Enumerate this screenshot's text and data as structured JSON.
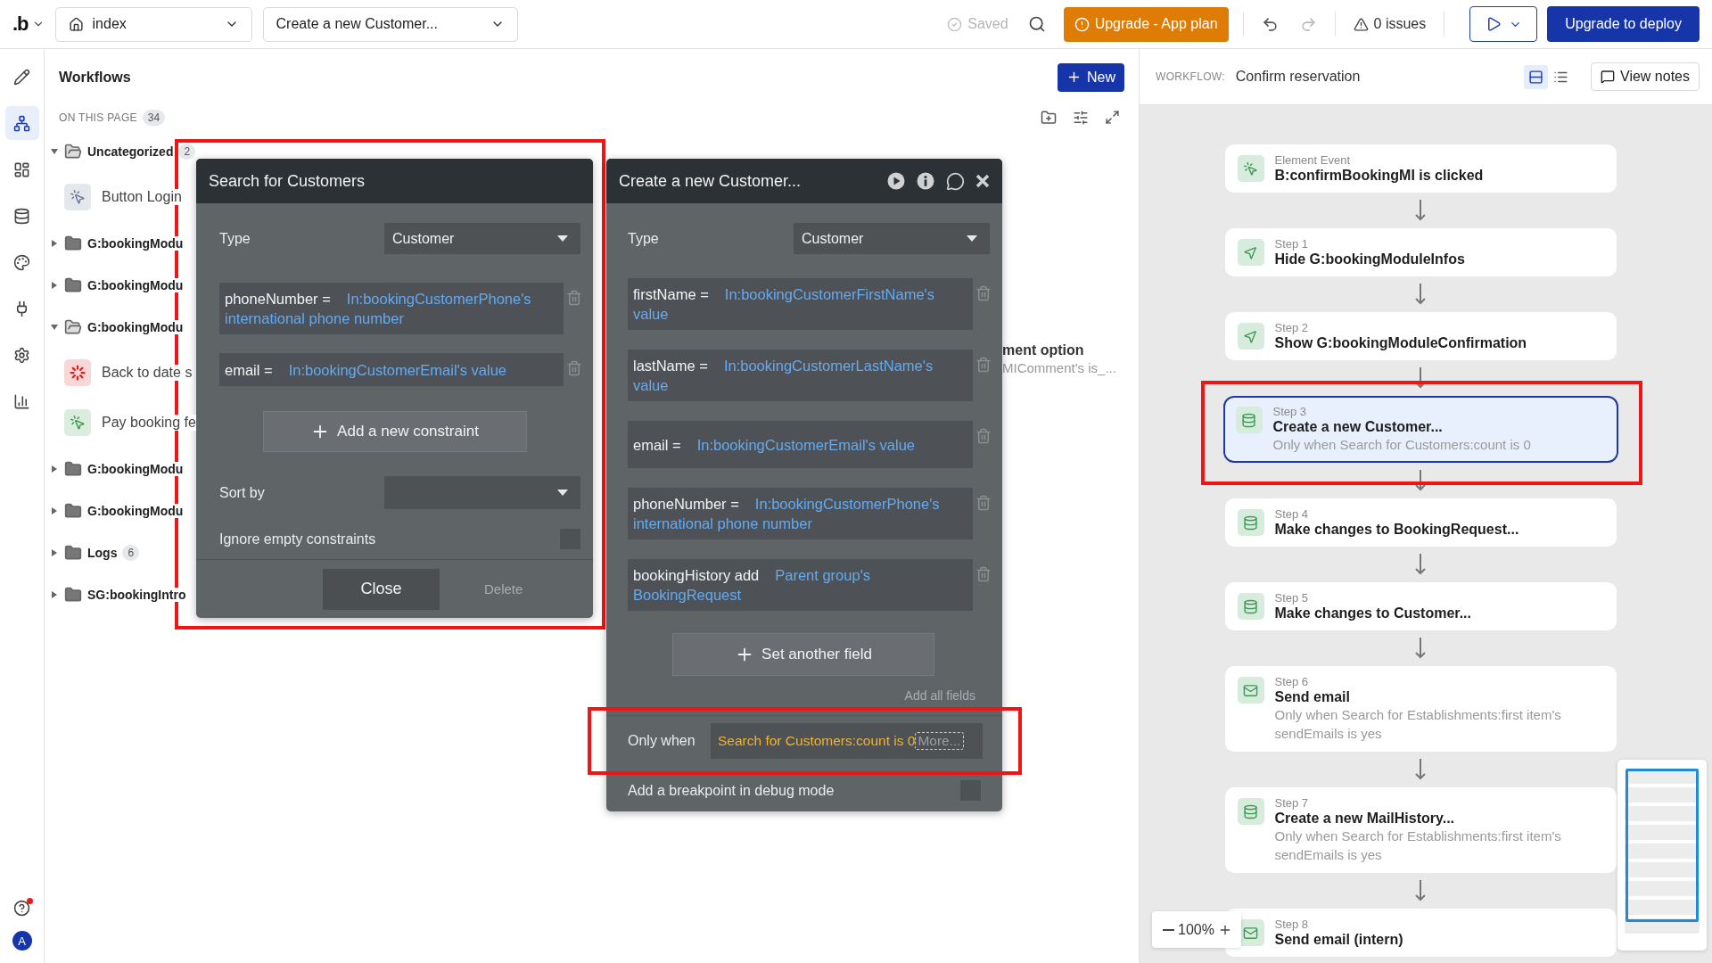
{
  "top_bar": {
    "logo": ".b",
    "page_selector": "index",
    "workflow_selector": "Create a new Customer...",
    "saved": "Saved",
    "upgrade_plan": "Upgrade - App plan",
    "issues": "0 issues",
    "deploy": "Upgrade to deploy"
  },
  "rail": {
    "items": [
      {
        "kind": "design",
        "selected": false
      },
      {
        "kind": "workflow",
        "selected": true
      },
      {
        "kind": "layout",
        "selected": false
      },
      {
        "kind": "data",
        "selected": false
      },
      {
        "kind": "styles",
        "selected": false
      },
      {
        "kind": "plugins",
        "selected": false
      },
      {
        "kind": "settings",
        "selected": false
      },
      {
        "kind": "logs",
        "selected": false
      }
    ],
    "help_notification": true,
    "avatar": "A"
  },
  "workflows_panel": {
    "title": "Workflows",
    "new_button": "New",
    "section_label": "ON THIS PAGE",
    "section_count": "34",
    "tree": [
      {
        "label": "Uncategorized",
        "count": "2",
        "expanded": true,
        "children": [
          {
            "label": "Button Login",
            "kind": "event",
            "color": "#6b7c93"
          }
        ]
      },
      {
        "label": "G:bookingModu",
        "expanded": false
      },
      {
        "label": "G:bookingModu",
        "expanded": false
      },
      {
        "label": "G:bookingModu",
        "expanded": true,
        "children": [
          {
            "label": "Back to date s",
            "kind": "alert",
            "color": "#e02020"
          },
          {
            "label": "Pay booking fe",
            "kind": "event",
            "color": "#3a9a4e"
          }
        ]
      },
      {
        "label": "G:bookingModu",
        "expanded": false
      },
      {
        "label": "G:bookingModu",
        "expanded": false
      },
      {
        "label": "Logs",
        "count": "6",
        "expanded": false
      },
      {
        "label": "SG:bookingIntro",
        "expanded": false
      }
    ],
    "hidden_item": {
      "title": "ment option",
      "subtitle": "MIComment's is_..."
    }
  },
  "search_panel": {
    "title": "Search for Customers",
    "highlighted": true,
    "type_label": "Type",
    "type_value": "Customer",
    "constraints": [
      {
        "field": "phoneNumber =",
        "value": "In:bookingCustomerPhone's international phone number"
      },
      {
        "field": "email =",
        "value": "In:bookingCustomerEmail's value"
      }
    ],
    "add_constraint": "Add a new constraint",
    "sort_label": "Sort by",
    "ignore_label": "Ignore empty constraints",
    "ignore_checked": false,
    "close": "Close",
    "delete": "Delete"
  },
  "create_panel": {
    "title": "Create a new Customer...",
    "type_label": "Type",
    "type_value": "Customer",
    "fields": [
      {
        "field": "firstName  =",
        "value": "In:bookingCustomerFirstName's value"
      },
      {
        "field": "lastName  =",
        "value": "In:bookingCustomerLastName's value"
      },
      {
        "field": "email  =",
        "value": "In:bookingCustomerEmail's value"
      },
      {
        "field": "phoneNumber  =",
        "value": "In:bookingCustomerPhone's international phone number"
      },
      {
        "field": "bookingHistory add",
        "value": "Parent group's BookingRequest"
      }
    ],
    "set_field": "Set another field",
    "add_all": "Add all fields",
    "only_when_label": "Only when",
    "condition": "Search for Customers:count is 0",
    "more": "More...",
    "condition_highlighted": true,
    "breakpoint_label": "Add a breakpoint in debug mode",
    "breakpoint_checked": false
  },
  "workflow_view": {
    "label": "WORKFLOW:",
    "name": "Confirm reservation",
    "view_notes": "View notes",
    "layout_modes": [
      {
        "kind": "cards",
        "selected": true
      },
      {
        "kind": "list",
        "selected": false
      }
    ],
    "steps": [
      {
        "label": "Element Event",
        "title": "B:confirmBookingMI is clicked",
        "kind": "event",
        "selected": false
      },
      {
        "label": "Step 1",
        "title": "Hide G:bookingModuleInfos",
        "kind": "element",
        "selected": false
      },
      {
        "label": "Step 2",
        "title": "Show G:bookingModuleConfirmation",
        "kind": "element",
        "selected": false
      },
      {
        "label": "Step 3",
        "title": "Create a new Customer...",
        "condition": "Only when Search for Customers:count is 0",
        "kind": "data",
        "selected": true,
        "highlighted": true
      },
      {
        "label": "Step 4",
        "title": "Make changes to BookingRequest...",
        "kind": "data",
        "selected": false
      },
      {
        "label": "Step 5",
        "title": "Make changes to Customer...",
        "kind": "data",
        "selected": false
      },
      {
        "label": "Step 6",
        "title": "Send email",
        "condition": "Only when Search for Establishments:first item's sendEmails is yes",
        "kind": "email",
        "selected": false
      },
      {
        "label": "Step 7",
        "title": "Create a new MailHistory...",
        "condition": "Only when Search for Establishments:first item's sendEmails is yes",
        "kind": "data",
        "selected": false
      },
      {
        "label": "Step 8",
        "title": "Send email (intern)",
        "kind": "email",
        "selected": false
      }
    ],
    "zoom": "100%"
  }
}
